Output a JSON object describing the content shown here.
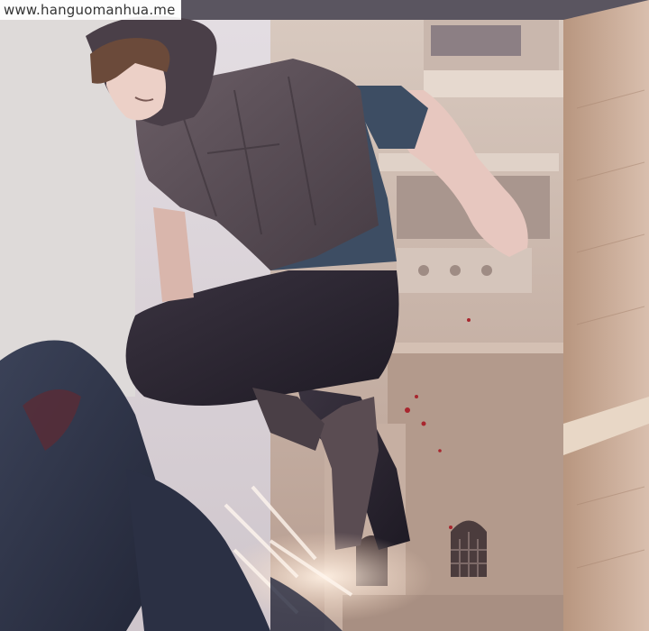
{
  "watermark": {
    "text": "www.hanguomanhua.me"
  },
  "palette": {
    "sky_wall": "#d9d3d8",
    "building": "#cdb8ae",
    "brick_wall": "#c8a896",
    "cloak": "#5c5058",
    "shirt": "#3d4d63",
    "pants": "#2a2530",
    "skin": "#e8c8c0",
    "hair": "#6b4a3a",
    "foreground_figure": "#30364a"
  }
}
